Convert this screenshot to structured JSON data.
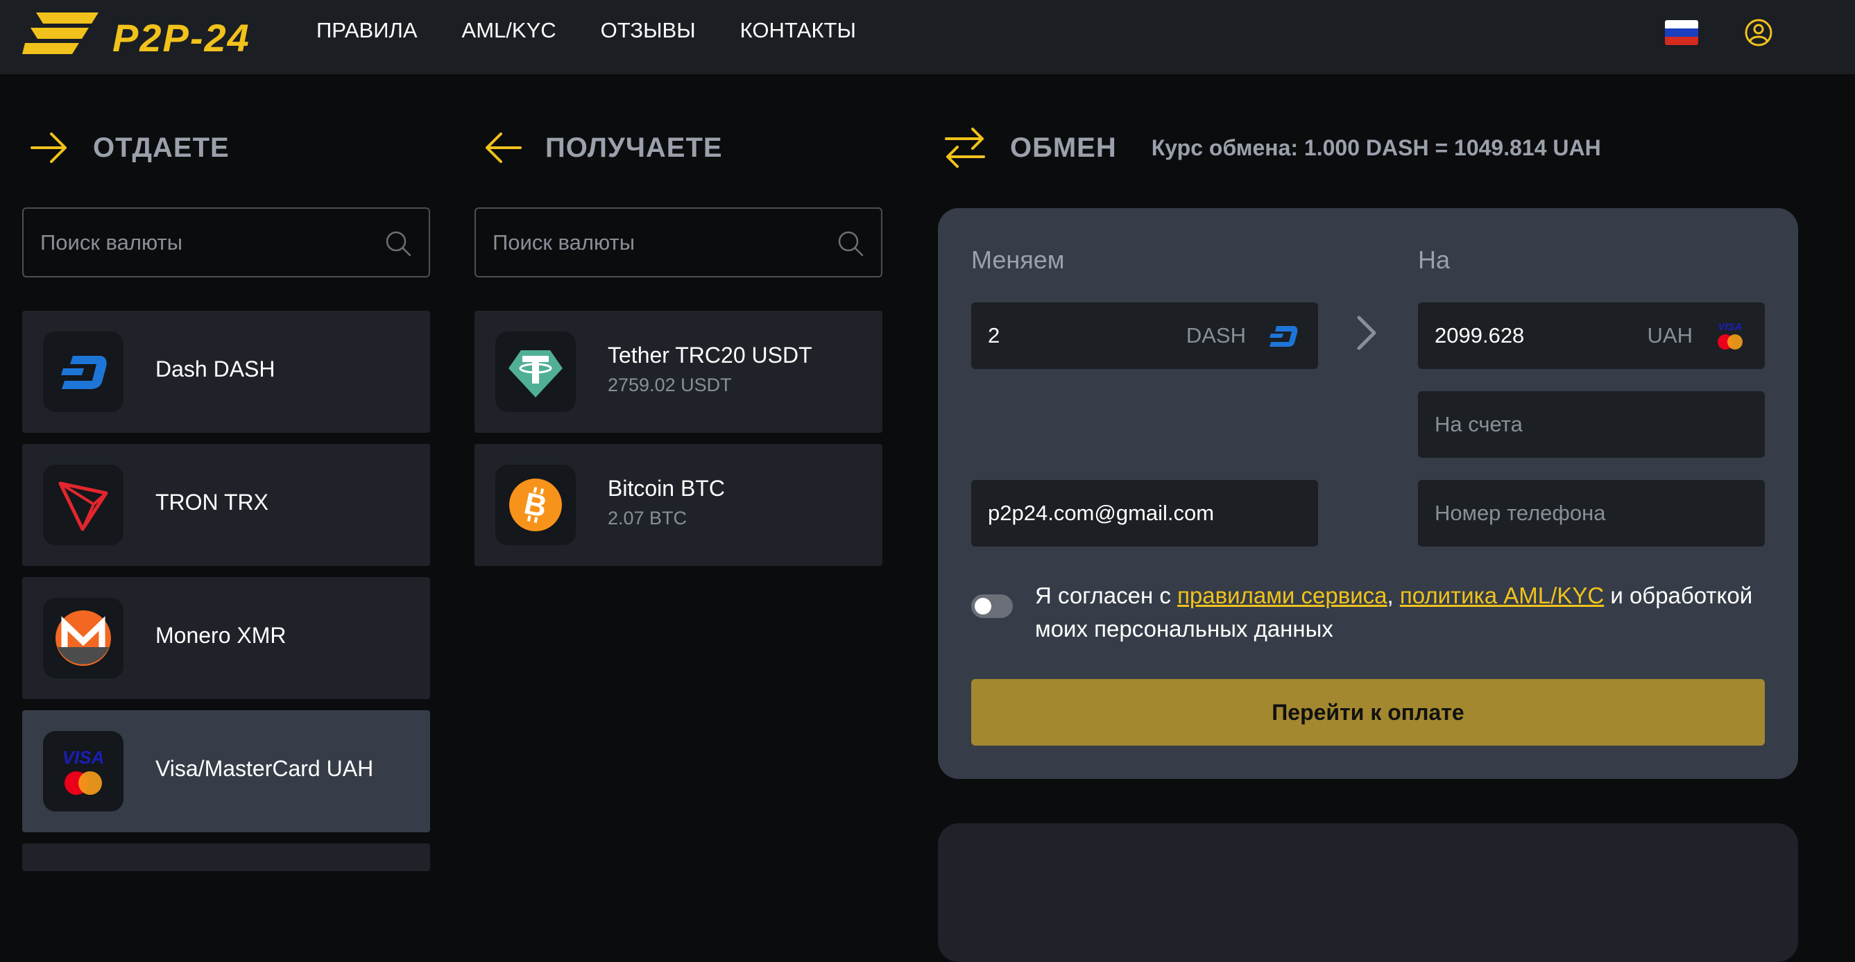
{
  "header": {
    "logo_text": "P2P-24",
    "nav": [
      "ПРАВИЛА",
      "AML/KYC",
      "ОТЗЫВЫ",
      "КОНТАКТЫ"
    ]
  },
  "give": {
    "title": "ОТДАЕТЕ",
    "search_placeholder": "Поиск валюты",
    "items": [
      {
        "name": "Dash DASH",
        "icon": "dash-icon"
      },
      {
        "name": "TRON TRX",
        "icon": "tron-icon"
      },
      {
        "name": "Monero XMR",
        "icon": "monero-icon"
      },
      {
        "name": "Visa/MasterCard UAH",
        "icon": "visa-mastercard-icon"
      }
    ]
  },
  "receive": {
    "title": "ПОЛУЧАЕТЕ",
    "search_placeholder": "Поиск валюты",
    "items": [
      {
        "name": "Tether TRC20 USDT",
        "reserve": "2759.02 USDT",
        "icon": "tether-icon"
      },
      {
        "name": "Bitcoin BTC",
        "reserve": "2.07 BTC",
        "icon": "bitcoin-icon"
      }
    ]
  },
  "exchange": {
    "title": "ОБМЕН",
    "rate": "Курс обмена: 1.000 DASH = 1049.814 UAH",
    "from_label": "Меняем",
    "to_label": "На",
    "from_amount": "2",
    "from_currency": "DASH",
    "to_amount": "2099.628",
    "to_currency": "UAH",
    "account_placeholder": "На счета",
    "email_value": "p2p24.com@gmail.com",
    "phone_placeholder": "Номер телефона",
    "agree_prefix": "Я согласен с",
    "agree_link1": "правилами сервиса",
    "agree_sep": ",",
    "agree_link2": "политика AML/KYC",
    "agree_suffix": "и обработкой моих персональных данных",
    "pay_button": "Перейти к оплате"
  },
  "colors": {
    "accent": "#f1c21b",
    "button": "#a3882f",
    "panel": "#363d48",
    "card": "#1f2329"
  }
}
